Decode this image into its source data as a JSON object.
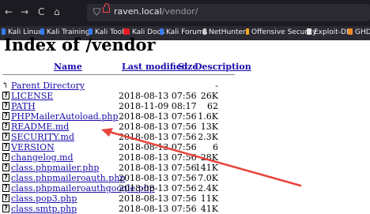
{
  "browser": {
    "url_host": "raven.local",
    "url_path": "/vendor/",
    "nav": {
      "back": "←",
      "forward": "→",
      "reload": "C",
      "home": "⌂"
    },
    "bookmarks": [
      {
        "label": "Kali Linux",
        "color": "#367bf0"
      },
      {
        "label": "Kali Training",
        "color": "#367bf0"
      },
      {
        "label": "Kali Tools",
        "color": "#367bf0"
      },
      {
        "label": "Kali Docs",
        "color": "#e31e24"
      },
      {
        "label": "Kali Forums",
        "color": "#367bf0"
      },
      {
        "label": "NetHunter",
        "color": "#d0d0d0"
      },
      {
        "label": "Offensive Security",
        "color": "#f5a623"
      },
      {
        "label": "Exploit-DB",
        "color": "#e8e8e8"
      },
      {
        "label": "GHDB",
        "color": "#f08a24"
      }
    ]
  },
  "page": {
    "title": "Index of /vendor",
    "headers": {
      "name": "Name",
      "modified": "Last modified",
      "size": "Size",
      "description": "Description"
    },
    "parent": {
      "name": "Parent Directory",
      "size": "-"
    },
    "rows": [
      {
        "name": "LICENSE",
        "date": "2018-08-13 07:56",
        "size": "26K"
      },
      {
        "name": "PATH",
        "date": "2018-11-09 08:17",
        "size": "62"
      },
      {
        "name": "PHPMailerAutoload.php",
        "date": "2018-08-13 07:56",
        "size": "1.6K"
      },
      {
        "name": "README.md",
        "date": "2018-08-13 07:56",
        "size": "13K"
      },
      {
        "name": "SECURITY.md",
        "date": "2018-08-13 07:56",
        "size": "2.3K"
      },
      {
        "name": "VERSION",
        "date": "2018-08-13 07:56",
        "size": "6"
      },
      {
        "name": "changelog.md",
        "date": "2018-08-13 07:56",
        "size": "28K"
      },
      {
        "name": "class.phpmailer.php",
        "date": "2018-08-13 07:56",
        "size": "141K"
      },
      {
        "name": "class.phpmaileroauth.php",
        "date": "2018-08-13 07:56",
        "size": "7.0K"
      },
      {
        "name": "class.phpmaileroauthgoogle.php",
        "date": "2018-08-13 07:56",
        "size": "2.4K"
      },
      {
        "name": "class.pop3.php",
        "date": "2018-08-13 07:56",
        "size": "11K"
      },
      {
        "name": "class.smtp.php",
        "date": "2018-08-13 07:56",
        "size": "41K"
      }
    ]
  },
  "annotation": {
    "arrow_color": "#e8453c"
  }
}
